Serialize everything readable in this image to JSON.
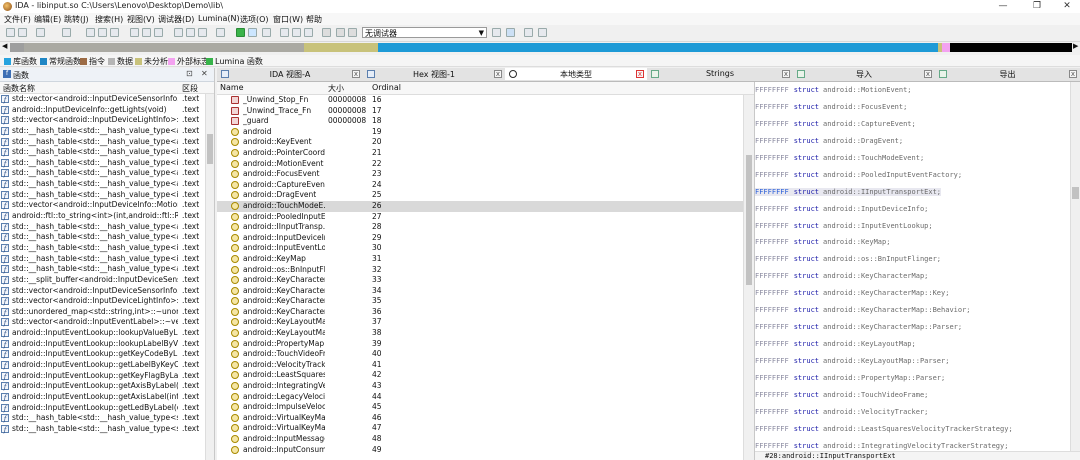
{
  "window": {
    "title": "IDA - libinput.so C:\\Users\\Lenovo\\Desktop\\Demo\\lib\\",
    "controls": [
      "—",
      "❐",
      "✕"
    ]
  },
  "menu": [
    "文件(F)",
    "编辑(E)",
    "跳转(J)",
    "搜索(H)",
    "视图(V)",
    "调试器(D)",
    "Lumina(N)",
    "选项(O)",
    "窗口(W)",
    "帮助"
  ],
  "toolbar": {
    "debugger_select": "无调试器"
  },
  "colors": {
    "library": "#27a3de",
    "regular": "#1f86c4",
    "instruction": "#9c6b44",
    "data": "#b5b5b5",
    "unexplored": "#c8c27a",
    "external": "#f3a2f0",
    "lumina": "#37b34a"
  },
  "legend": [
    {
      "label": "库函数",
      "color": "#27a3de"
    },
    {
      "label": "常规函数",
      "color": "#1f86c4"
    },
    {
      "label": "指令",
      "color": "#9c6b44"
    },
    {
      "label": "数据",
      "color": "#b5b5b5"
    },
    {
      "label": "未分析",
      "color": "#c8c27a"
    },
    {
      "label": "外部标志",
      "color": "#f3a2f0"
    },
    {
      "label": "Lumina 函数",
      "color": "#37b34a"
    }
  ],
  "functions_panel": {
    "title": "函数",
    "controls": [
      "⊡",
      "✕"
    ],
    "col_name": "函数名称",
    "col_seg": "区段",
    "rows": [
      {
        "name": "std::vector<android::InputDeviceSensorInfo...",
        "seg": ".text"
      },
      {
        "name": "android::InputDeviceInfo::getLights(void)",
        "seg": ".text"
      },
      {
        "name": "std::vector<android::InputDeviceLightInfo>::r...",
        "seg": ".text"
      },
      {
        "name": "std::__hash_table<std::__hash_value_type<an...",
        "seg": ".text"
      },
      {
        "name": "std::__hash_table<std::__hash_value_type<an...",
        "seg": ".text"
      },
      {
        "name": "std::__hash_table<std::__hash_value_type<in...",
        "seg": ".text"
      },
      {
        "name": "std::__hash_table<std::__hash_value_type<int...",
        "seg": ".text"
      },
      {
        "name": "std::__hash_table<std::__hash_value_type<an...",
        "seg": ".text"
      },
      {
        "name": "std::__hash_table<std::__hash_value_type<an...",
        "seg": ".text"
      },
      {
        "name": "std::__hash_table<std::__hash_value_type<int...",
        "seg": ".text"
      },
      {
        "name": "std::vector<android::InputDeviceInfo::Motion...",
        "seg": ".text"
      },
      {
        "name": "android::ftl::to_string<int>(int,android::ftl::Ra...",
        "seg": ".text"
      },
      {
        "name": "std::__hash_table<std::__hash_value_type<an...",
        "seg": ".text"
      },
      {
        "name": "std::__hash_table<std::__hash_value_type<an...",
        "seg": ".text"
      },
      {
        "name": "std::__hash_table<std::__hash_value_type<int...",
        "seg": ".text"
      },
      {
        "name": "std::__hash_table<std::__hash_value_type<int...",
        "seg": ".text"
      },
      {
        "name": "std::__hash_table<std::__hash_value_type<an...",
        "seg": ".text"
      },
      {
        "name": "std::__split_buffer<android::InputDeviceSens...",
        "seg": ".text"
      },
      {
        "name": "std::vector<android::InputDeviceSensorInfo...",
        "seg": ".text"
      },
      {
        "name": "std::vector<android::InputDeviceLightInfo>::_...",
        "seg": ".text"
      },
      {
        "name": "std::unordered_map<std::string,int>::~unord...",
        "seg": ".text"
      },
      {
        "name": "std::vector<android::InputEventLabel>::~vect...",
        "seg": ".text"
      },
      {
        "name": "android::InputEventLookup::lookupValueByL...",
        "seg": ".text"
      },
      {
        "name": "android::InputEventLookup::lookupLabelByV...",
        "seg": ".text"
      },
      {
        "name": "android::InputEventLookup::getKeyCodeByL...",
        "seg": ".text"
      },
      {
        "name": "android::InputEventLookup::getLabelByKeyC...",
        "seg": ".text"
      },
      {
        "name": "android::InputEventLookup::getKeyFlagByLa...",
        "seg": ".text"
      },
      {
        "name": "android::InputEventLookup::getAxisByLabel(c...",
        "seg": ".text"
      },
      {
        "name": "android::InputEventLookup::getAxisLabel(int)",
        "seg": ".text"
      },
      {
        "name": "android::InputEventLookup::getLedByLabel(c...",
        "seg": ".text"
      },
      {
        "name": "std::__hash_table<std::__hash_value_type<std...",
        "seg": ".text"
      },
      {
        "name": "std::__hash_table<std::__hash_value_type<std...",
        "seg": ".text"
      }
    ]
  },
  "tabs": [
    {
      "label": "IDA 视图-A"
    },
    {
      "label": "Hex 视图-1"
    },
    {
      "label": "本地类型"
    },
    {
      "label": "Strings"
    },
    {
      "label": "导入"
    },
    {
      "label": "导出"
    }
  ],
  "local_types": {
    "col_name": "Name",
    "col_size": "大小",
    "col_ordinal": "Ordinal",
    "rows": [
      {
        "name": "_Unwind_Stop_Fn",
        "size": "00000008",
        "ord": "16",
        "kind": "enum"
      },
      {
        "name": "_Unwind_Trace_Fn",
        "size": "00000008",
        "ord": "17",
        "kind": "enum"
      },
      {
        "name": "_guard",
        "size": "00000008",
        "ord": "18",
        "kind": "enum"
      },
      {
        "name": "android",
        "size": "",
        "ord": "19",
        "kind": "struct"
      },
      {
        "name": "android::KeyEvent",
        "size": "",
        "ord": "20",
        "kind": "struct"
      },
      {
        "name": "android::PointerCoords",
        "size": "",
        "ord": "21",
        "kind": "struct"
      },
      {
        "name": "android::MotionEvent",
        "size": "",
        "ord": "22",
        "kind": "struct"
      },
      {
        "name": "android::FocusEvent",
        "size": "",
        "ord": "23",
        "kind": "struct"
      },
      {
        "name": "android::CaptureEvent",
        "size": "",
        "ord": "24",
        "kind": "struct"
      },
      {
        "name": "android::DragEvent",
        "size": "",
        "ord": "25",
        "kind": "struct"
      },
      {
        "name": "android::TouchModeE...",
        "size": "",
        "ord": "26",
        "kind": "struct"
      },
      {
        "name": "android::PooledInputE...",
        "size": "",
        "ord": "27",
        "kind": "struct"
      },
      {
        "name": "android::IInputTransp...",
        "size": "",
        "ord": "28",
        "kind": "struct"
      },
      {
        "name": "android::InputDeviceInfo",
        "size": "",
        "ord": "29",
        "kind": "struct"
      },
      {
        "name": "android::InputEventLo...",
        "size": "",
        "ord": "30",
        "kind": "struct"
      },
      {
        "name": "android::KeyMap",
        "size": "",
        "ord": "31",
        "kind": "struct"
      },
      {
        "name": "android::os::BnInputFli...",
        "size": "",
        "ord": "32",
        "kind": "struct"
      },
      {
        "name": "android::KeyCharacter...",
        "size": "",
        "ord": "33",
        "kind": "struct"
      },
      {
        "name": "android::KeyCharacter...",
        "size": "",
        "ord": "34",
        "kind": "struct"
      },
      {
        "name": "android::KeyCharacter...",
        "size": "",
        "ord": "35",
        "kind": "struct"
      },
      {
        "name": "android::KeyCharacter...",
        "size": "",
        "ord": "36",
        "kind": "struct"
      },
      {
        "name": "android::KeyLayoutMap",
        "size": "",
        "ord": "37",
        "kind": "struct"
      },
      {
        "name": "android::KeyLayoutMa...",
        "size": "",
        "ord": "38",
        "kind": "struct"
      },
      {
        "name": "android::PropertyMap:...",
        "size": "",
        "ord": "39",
        "kind": "struct"
      },
      {
        "name": "android::TouchVideoFr...",
        "size": "",
        "ord": "40",
        "kind": "struct"
      },
      {
        "name": "android::VelocityTracker",
        "size": "",
        "ord": "41",
        "kind": "struct"
      },
      {
        "name": "android::LeastSquares...",
        "size": "",
        "ord": "42",
        "kind": "struct"
      },
      {
        "name": "android::IntegratingVe...",
        "size": "",
        "ord": "43",
        "kind": "struct"
      },
      {
        "name": "android::LegacyVelocit...",
        "size": "",
        "ord": "44",
        "kind": "struct"
      },
      {
        "name": "android::ImpulseVeloc...",
        "size": "",
        "ord": "45",
        "kind": "struct"
      },
      {
        "name": "android::VirtualKeyMap",
        "size": "",
        "ord": "46",
        "kind": "struct"
      },
      {
        "name": "android::VirtualKeyMa...",
        "size": "",
        "ord": "47",
        "kind": "struct"
      },
      {
        "name": "android::InputMessage",
        "size": "",
        "ord": "48",
        "kind": "struct"
      },
      {
        "name": "android::InputConsumer",
        "size": "",
        "ord": "49",
        "kind": "struct"
      }
    ]
  },
  "declarations": {
    "rows": [
      {
        "prefix": "FFFFFFFF",
        "kw": "struct",
        "name": "android::MotionEvent;"
      },
      {
        "prefix": "FFFFFFFF",
        "kw": "struct",
        "name": "android::FocusEvent;"
      },
      {
        "prefix": "FFFFFFFF",
        "kw": "struct",
        "name": "android::CaptureEvent;"
      },
      {
        "prefix": "FFFFFFFF",
        "kw": "struct",
        "name": "android::DragEvent;"
      },
      {
        "prefix": "FFFFFFFF",
        "kw": "struct",
        "name": "android::TouchModeEvent;"
      },
      {
        "prefix": "FFFFFFFF",
        "kw": "struct",
        "name": "android::PooledInputEventFactory;"
      },
      {
        "prefix": "FFFFFFFF",
        "kw": "struct",
        "name": "android::IInputTransportExt;"
      },
      {
        "prefix": "FFFFFFFF",
        "kw": "struct",
        "name": "android::InputDeviceInfo;"
      },
      {
        "prefix": "FFFFFFFF",
        "kw": "struct",
        "name": "android::InputEventLookup;"
      },
      {
        "prefix": "FFFFFFFF",
        "kw": "struct",
        "name": "android::KeyMap;"
      },
      {
        "prefix": "FFFFFFFF",
        "kw": "struct",
        "name": "android::os::BnInputFlinger;"
      },
      {
        "prefix": "FFFFFFFF",
        "kw": "struct",
        "name": "android::KeyCharacterMap;"
      },
      {
        "prefix": "FFFFFFFF",
        "kw": "struct",
        "name": "android::KeyCharacterMap::Key;"
      },
      {
        "prefix": "FFFFFFFF",
        "kw": "struct",
        "name": "android::KeyCharacterMap::Behavior;"
      },
      {
        "prefix": "FFFFFFFF",
        "kw": "struct",
        "name": "android::KeyCharacterMap::Parser;"
      },
      {
        "prefix": "FFFFFFFF",
        "kw": "struct",
        "name": "android::KeyLayoutMap;"
      },
      {
        "prefix": "FFFFFFFF",
        "kw": "struct",
        "name": "android::KeyLayoutMap::Parser;"
      },
      {
        "prefix": "FFFFFFFF",
        "kw": "struct",
        "name": "android::PropertyMap::Parser;"
      },
      {
        "prefix": "FFFFFFFF",
        "kw": "struct",
        "name": "android::TouchVideoFrame;"
      },
      {
        "prefix": "FFFFFFFF",
        "kw": "struct",
        "name": "android::VelocityTracker;"
      },
      {
        "prefix": "FFFFFFFF",
        "kw": "struct",
        "name": "android::LeastSquaresVelocityTrackerStrategy;"
      },
      {
        "prefix": "FFFFFFFF",
        "kw": "struct",
        "name": "android::IntegratingVelocityTrackerStrategy;"
      }
    ],
    "status": "#28:android::IInputTransportExt"
  }
}
